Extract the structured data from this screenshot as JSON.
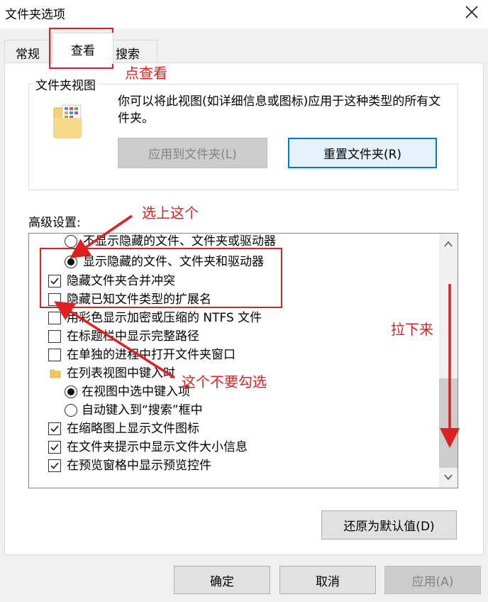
{
  "window": {
    "title": "文件夹选项"
  },
  "tabs": [
    {
      "label": "常规"
    },
    {
      "label": "查看"
    },
    {
      "label": "搜索"
    }
  ],
  "folder_views": {
    "legend": "文件夹视图",
    "description": "你可以将此视图(如详细信息或图标)应用于这种类型的所有文件夹。",
    "apply_button": "应用到文件夹(L)",
    "reset_button": "重置文件夹(R)"
  },
  "advanced": {
    "label": "高级设置:",
    "items": [
      {
        "type": "radio",
        "checked": false,
        "label": "不显示隐藏的文件、文件夹或驱动器"
      },
      {
        "type": "radio",
        "checked": true,
        "label": "显示隐藏的文件、文件夹和驱动器"
      },
      {
        "type": "checkbox",
        "checked": true,
        "label": "隐藏文件夹合并冲突"
      },
      {
        "type": "checkbox",
        "checked": false,
        "label": "隐藏已知文件类型的扩展名"
      },
      {
        "type": "checkbox",
        "checked": false,
        "label": "用彩色显示加密或压缩的 NTFS 文件"
      },
      {
        "type": "checkbox",
        "checked": false,
        "label": "在标题栏中显示完整路径"
      },
      {
        "type": "checkbox",
        "checked": false,
        "label": "在单独的进程中打开文件夹窗口"
      },
      {
        "type": "folder",
        "label": "在列表视图中键入时"
      },
      {
        "type": "radio",
        "checked": true,
        "label": "在视图中选中键入项"
      },
      {
        "type": "radio",
        "checked": false,
        "label": "自动键入到“搜索”框中"
      },
      {
        "type": "checkbox",
        "checked": true,
        "label": "在缩略图上显示文件图标"
      },
      {
        "type": "checkbox",
        "checked": true,
        "label": "在文件夹提示中显示文件大小信息"
      },
      {
        "type": "checkbox",
        "checked": true,
        "label": "在预览窗格中显示预览控件"
      }
    ]
  },
  "buttons": {
    "restore_defaults": "还原为默认值(D)",
    "ok": "确定",
    "cancel": "取消",
    "apply": "应用(A)"
  },
  "annotations": {
    "click_view": "点查看",
    "select_this": "选上这个",
    "dont_check": "这个不要勾选",
    "scroll_down": "拉下来",
    "color": "#e02020"
  }
}
